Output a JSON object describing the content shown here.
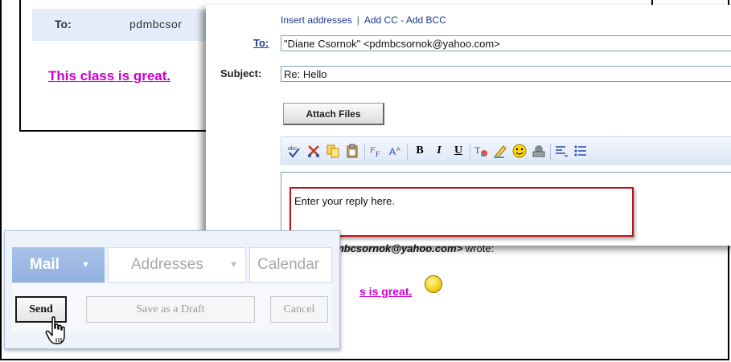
{
  "read_panel": {
    "to_label": "To:",
    "to_value": "pdmbcsor",
    "class_link": "This class is great."
  },
  "compose": {
    "insert_addresses": "Insert addresses",
    "separator": "|",
    "add_cc_bcc": "Add CC - Add BCC",
    "to_label": "To:",
    "to_value": "\"Diane Csornok\" <pdmbcsornok@yahoo.com>",
    "subject_label": "Subject:",
    "subject_value": "Re: Hello",
    "attach_label": "Attach Files",
    "editor_placeholder": "Enter your reply here.",
    "wrote_name": "nok <pdmbcsornok@yahoo.com>",
    "wrote_suffix": "wrote:",
    "quoted_link": "s is great."
  },
  "toolbar": {
    "icons": [
      "spellcheck-icon",
      "cut-icon",
      "copy-icon",
      "paste-icon",
      "font-icon",
      "font-size-icon",
      "bold-icon",
      "italic-icon",
      "underline-icon",
      "text-color-icon",
      "highlight-icon",
      "emoticon-icon",
      "stationery-icon",
      "align-icon",
      "bullet-list-icon"
    ],
    "bold": "B",
    "italic": "I",
    "underline": "U"
  },
  "mail_nav": {
    "tabs": [
      {
        "label": "Mail"
      },
      {
        "label": "Addresses"
      },
      {
        "label": "Calendar"
      }
    ],
    "send_label": "Send",
    "draft_label": "Save as a Draft",
    "cancel_label": "Cancel"
  },
  "colors": {
    "link_blue": "#1a3a8c",
    "magenta": "#cc00cc",
    "reply_border": "#b8141a",
    "mail_tab": "#90b0de"
  }
}
